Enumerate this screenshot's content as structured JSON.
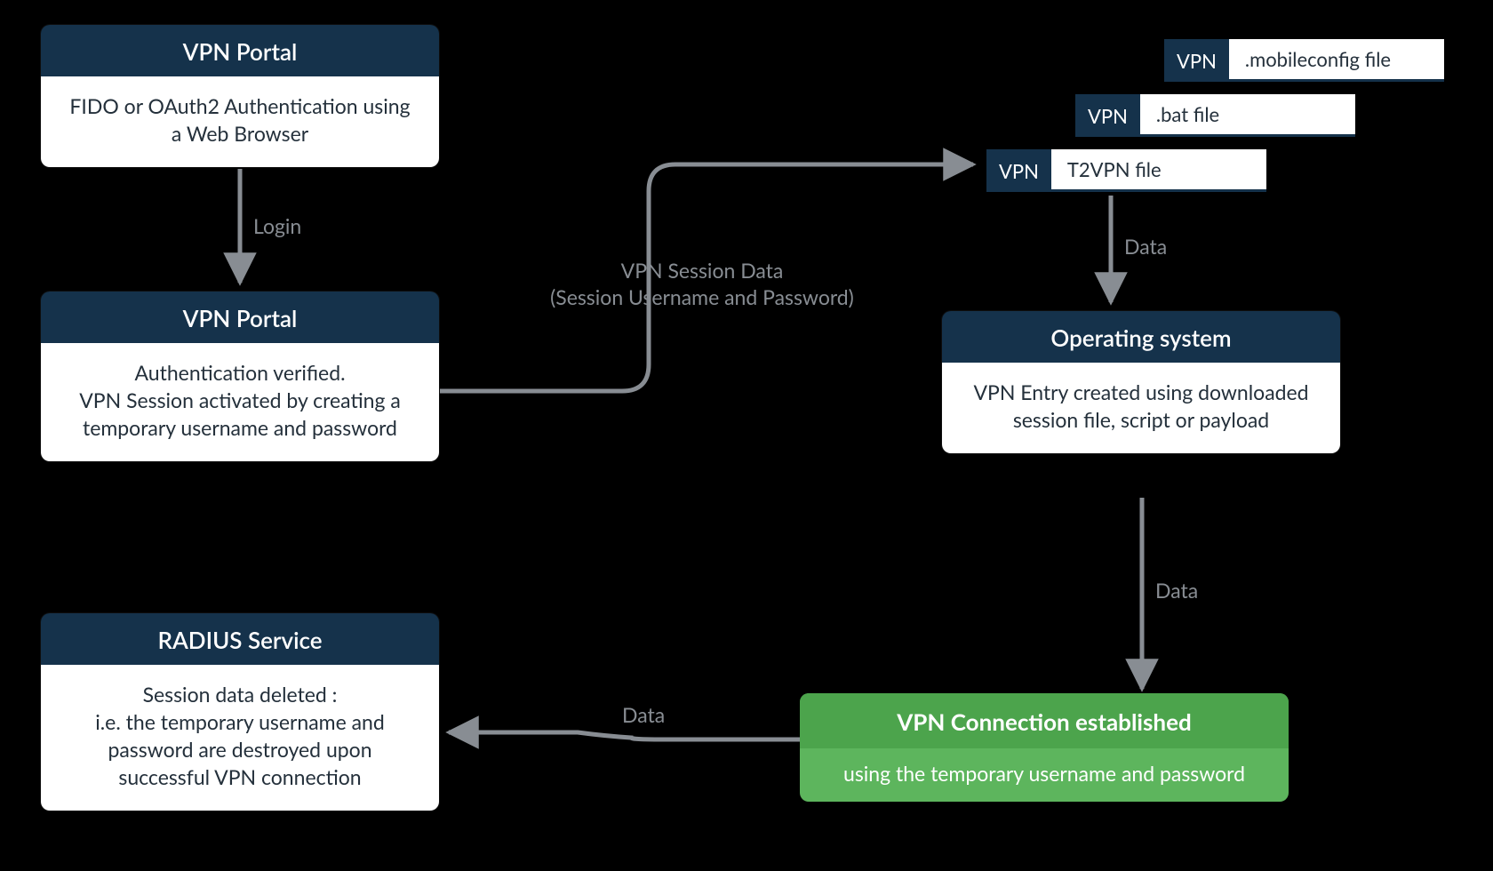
{
  "nodes": {
    "portal1": {
      "title": "VPN Portal",
      "body": "FIDO or OAuth2 Authentication using a Web Browser"
    },
    "portal2": {
      "title": "VPN Portal",
      "body": "Authentication verified.\nVPN Session activated by creating a temporary username and password"
    },
    "os": {
      "title": "Operating system",
      "body": "VPN Entry created using downloaded session file, script or payload"
    },
    "radius": {
      "title": "RADIUS Service",
      "body": "Session data deleted :\ni.e. the temporary username and password are destroyed upon successful VPN connection"
    },
    "established": {
      "title": "VPN Connection established",
      "body": "using the temporary username and password"
    }
  },
  "chips": {
    "label": "VPN",
    "files": {
      "mobileconfig": ".mobileconfig file",
      "bat": ".bat file",
      "t2vpn": "T2VPN file"
    }
  },
  "edges": {
    "login": "Login",
    "session_data": "VPN Session Data\n(Session Username and Password)",
    "data1": "Data",
    "data2": "Data",
    "data3": "Data"
  },
  "colors": {
    "navy": "#15324b",
    "grey": "#888d93",
    "green_header": "#4ca44c",
    "green_body": "#5db55d"
  }
}
